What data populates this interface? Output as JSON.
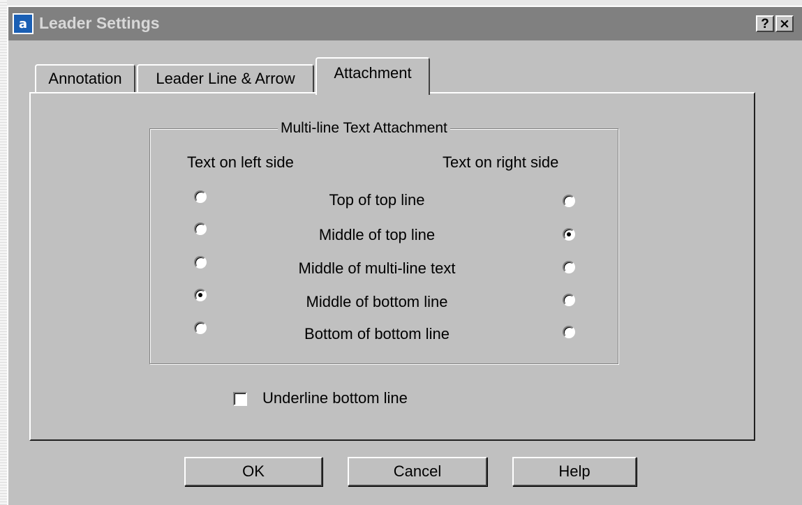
{
  "window": {
    "icon_glyph": "a",
    "icon_name": "leader-settings-icon",
    "title": "Leader Settings",
    "help_button": "?",
    "close_button": "×"
  },
  "tabs": [
    {
      "label": "Annotation",
      "active": false
    },
    {
      "label": "Leader Line & Arrow",
      "active": false
    },
    {
      "label": "Attachment",
      "active": true
    }
  ],
  "attachment": {
    "group_title": "Multi-line Text Attachment",
    "left_header": "Text on left side",
    "right_header": "Text on right side",
    "options": [
      {
        "label": "Top of top line",
        "left_selected": false,
        "right_selected": false
      },
      {
        "label": "Middle of top line",
        "left_selected": false,
        "right_selected": true
      },
      {
        "label": "Middle of multi-line text",
        "left_selected": false,
        "right_selected": false
      },
      {
        "label": "Middle of bottom line",
        "left_selected": true,
        "right_selected": false
      },
      {
        "label": "Bottom of bottom line",
        "left_selected": false,
        "right_selected": false
      }
    ],
    "underline": {
      "label": "Underline bottom line",
      "checked": false
    }
  },
  "buttons": {
    "ok": "OK",
    "cancel": "Cancel",
    "help": "Help"
  },
  "colors": {
    "dialog_bg": "#c0c0c0",
    "titlebar_inactive": "#808080",
    "icon_blue": "#1a5fb4"
  }
}
